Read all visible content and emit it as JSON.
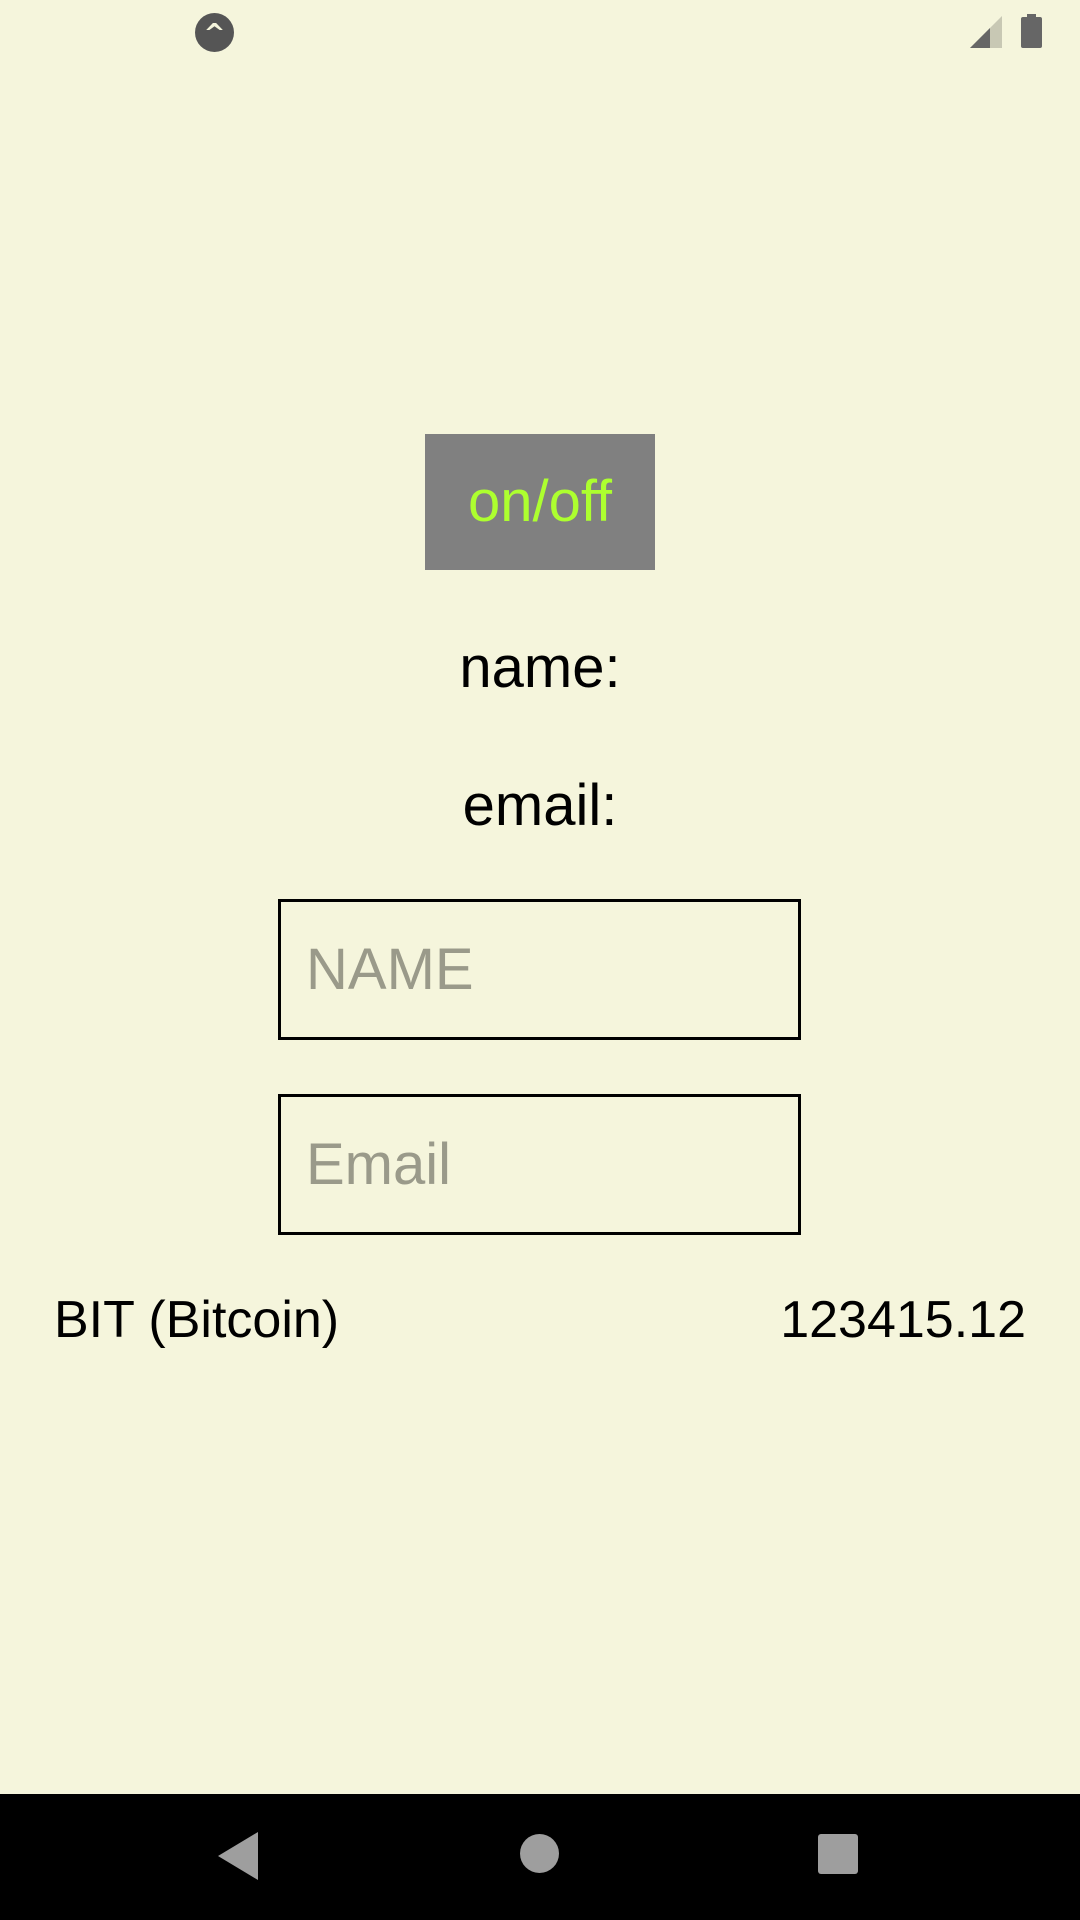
{
  "status_bar": {
    "app_badge_glyph": "^",
    "signal_icon": "cell-signal-icon",
    "battery_icon": "battery-icon"
  },
  "toggle": {
    "label": "on/off",
    "background_color": "#808080",
    "text_color": "#adff2f"
  },
  "display": {
    "name_label": "name:",
    "email_label": "email:"
  },
  "form": {
    "name_placeholder": "NAME",
    "email_placeholder": "Email"
  },
  "crypto": {
    "name": "BIT (Bitcoin)",
    "price": "123415.12"
  },
  "nav_bar": {
    "back_icon": "back-triangle-icon",
    "home_icon": "home-circle-icon",
    "recents_icon": "recents-square-icon"
  },
  "colors": {
    "background": "#f5f5dc",
    "placeholder": "#9a9a8a"
  }
}
